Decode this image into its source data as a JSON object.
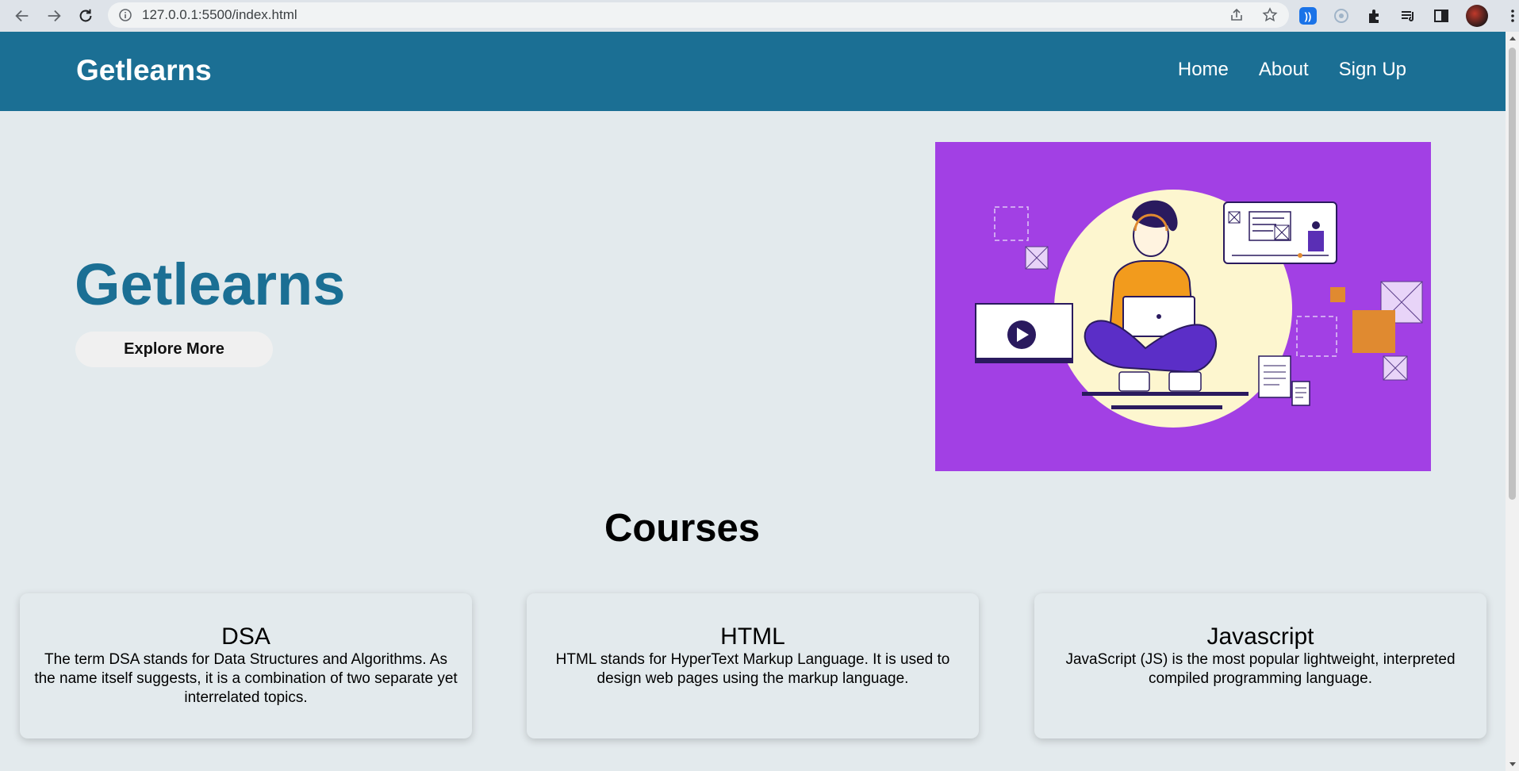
{
  "browser": {
    "url": "127.0.0.1:5500/index.html"
  },
  "nav": {
    "brand": "Getlearns",
    "links": [
      "Home",
      "About",
      "Sign Up"
    ]
  },
  "hero": {
    "title": "Getlearns",
    "button_label": "Explore More",
    "image_bg": "#a240e4"
  },
  "courses": {
    "heading": "Courses",
    "items": [
      {
        "title": "DSA",
        "text": "The term DSA stands for Data Structures and Algorithms. As the name itself suggests, it is a combination of two separate yet interrelated topics."
      },
      {
        "title": "HTML",
        "text": "HTML stands for HyperText Markup Language. It is used to design web pages using the markup language."
      },
      {
        "title": "Javascript",
        "text": "JavaScript (JS) is the most popular lightweight, interpreted compiled programming language."
      }
    ]
  },
  "colors": {
    "primary": "#1b6f94",
    "page_bg": "#e3eaed"
  }
}
